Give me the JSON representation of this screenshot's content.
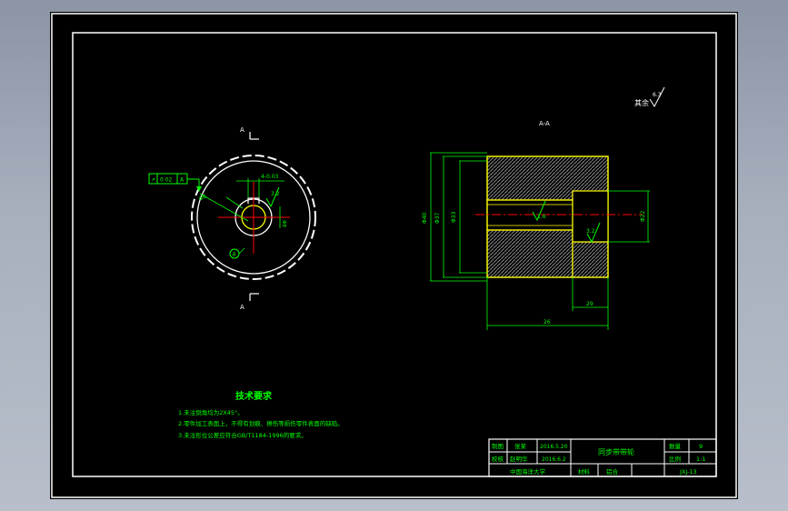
{
  "colors": {
    "frame": "#ffffff",
    "dimension": "#00ff00",
    "centerline": "#ff0000",
    "section": "#ffff00",
    "hatch": "#7f7f7f",
    "text": "#00ff00"
  },
  "marks": {
    "roughness_other": "其余",
    "roughness_other_value": "6.3",
    "section_label": "A-A",
    "section_mark_top": "A",
    "section_mark_bottom": "A",
    "runout_tol": "0.02",
    "runout_datum": "A",
    "datum_circle": "A",
    "roughness_front": "3.2",
    "roughness_bore": "1.6",
    "roughness_step": "3.2",
    "dim_keyway": "4-0.03",
    "dim_bore_front": "Φ8",
    "dim_outer": "Φ40",
    "dim_tooth": "Φ37",
    "dim_bore": "Φ33",
    "dim_right": "Φ22",
    "dim_length": "26",
    "dim_step": "29"
  },
  "tech": {
    "title": "技术要求",
    "lines": [
      "1.未注倒角均为2X45°。",
      "2.零件加工表面上，不得有划痕、擦伤等损伤零件表面的缺陷。",
      "3.未注形位公差应符合GB/T1184-1996的要求。"
    ]
  },
  "titleblock": {
    "drawn_label": "制图",
    "drawn_name": "张某",
    "drawn_date": "2016.5.20",
    "checked_label": "校核",
    "checked_name": "赵明华",
    "checked_date": "2016.6.2",
    "part_name": "同步带带轮",
    "qty_label": "数量",
    "qty_value": "9",
    "scale_label": "比例",
    "scale_value": "1:1",
    "school": "中国海洋大学",
    "material_label": "材料",
    "material_value": "铝合",
    "drawing_no": "JXJ-13"
  }
}
